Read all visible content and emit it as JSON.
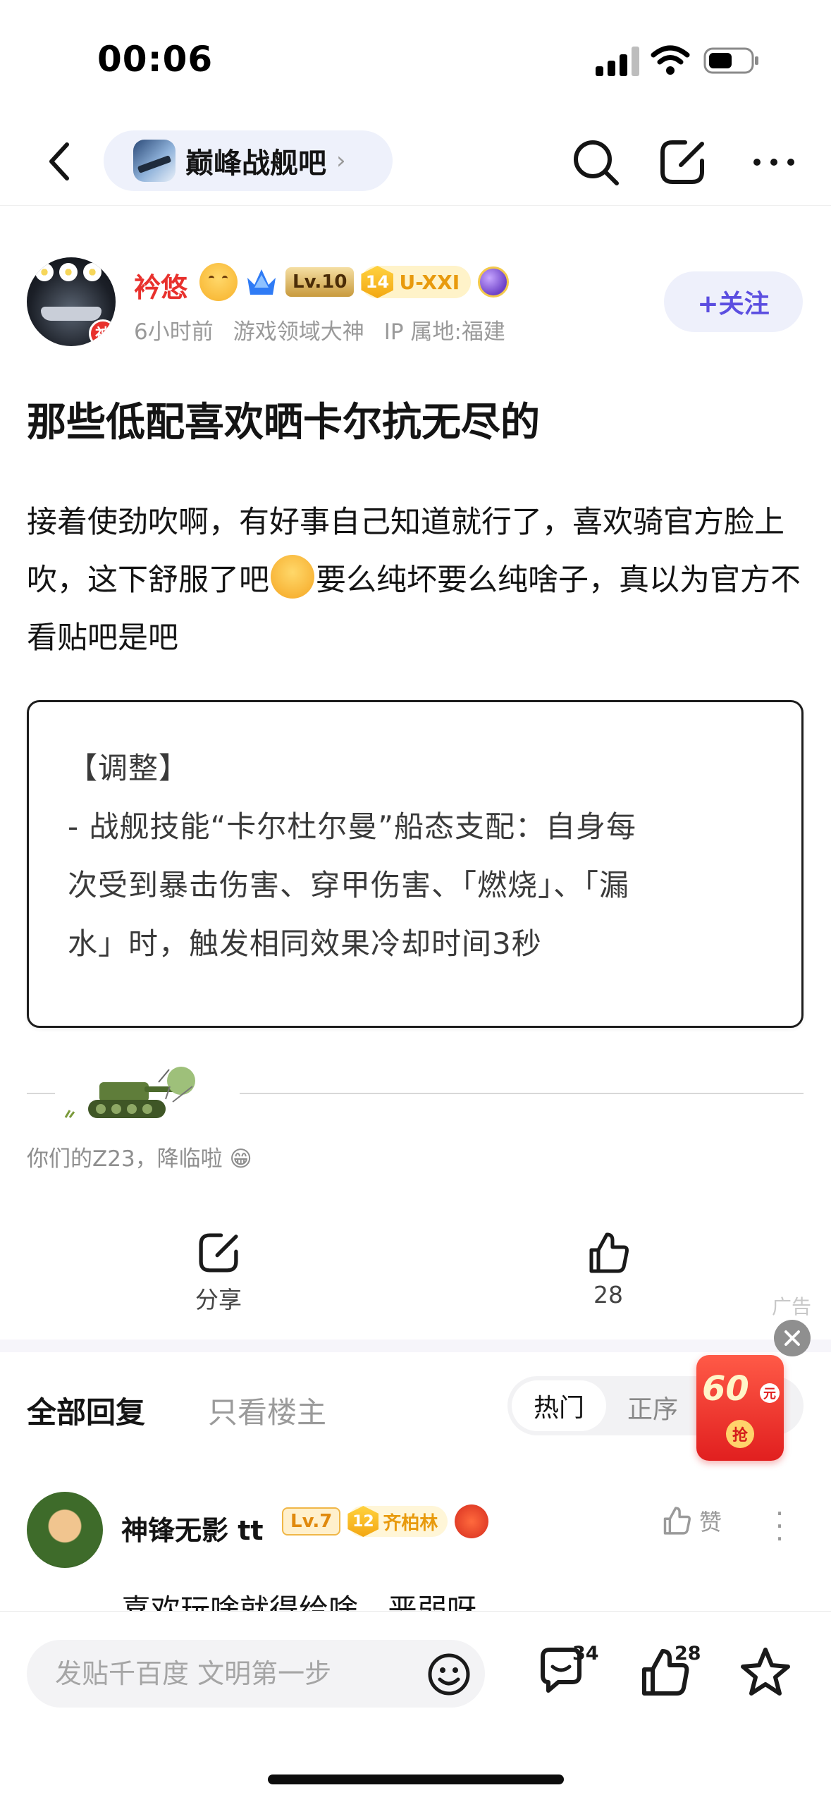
{
  "status": {
    "time": "00:06"
  },
  "nav": {
    "forum_name": "巅峰战舰吧"
  },
  "post": {
    "author": {
      "name": "衿悠",
      "badge_shen": "神",
      "level": "Lv.10",
      "title_level": "14",
      "title_text": "U-XXI",
      "time_ago": "6小时前",
      "honor": "游戏领域大神",
      "ip": "IP 属地:福建"
    },
    "follow_label": "+关注",
    "title": "那些低配喜欢晒卡尔抗无尽的",
    "body_part1": "接着使劲吹啊，有好事自己知道就行了，喜欢骑官方脸上吹，这下舒服了吧",
    "body_part2": "要么纯坏要么纯啥子，真以为官方不看贴吧是吧",
    "image_lines": [
      "【调整】",
      "- 战舰技能“卡尔杜尔曼”船态支配：自身每",
      "次受到暴击伤害、穿甲伤害、「燃烧」、「漏",
      "水」时，触发相同效果冷却时间3秒"
    ],
    "signature": "你们的Z23，降临啦 😁",
    "share_label": "分享",
    "like_count": "28",
    "ad_label": "广告"
  },
  "replies": {
    "tab_all": "全部回复",
    "tab_op": "只看楼主",
    "sort_hot": "热门",
    "sort_order": "正序",
    "redpacket_amount": "60",
    "redpacket_unit": "元",
    "redpacket_grab": "抢",
    "comments": [
      {
        "name": "神锋无影 tt",
        "level": "Lv.7",
        "title_level": "12",
        "title_text": "齐柏林",
        "like_label": "赞",
        "text": "喜欢玩啥就得给啥，恶弱呀"
      }
    ]
  },
  "bottom_bar": {
    "input_placeholder": "发贴千百度 文明第一步",
    "comment_count": "34",
    "like_count": "28"
  },
  "colors": {
    "accent": "#5b4ee0",
    "username_red": "#e8312d",
    "text_gray": "#9a9a9a"
  }
}
